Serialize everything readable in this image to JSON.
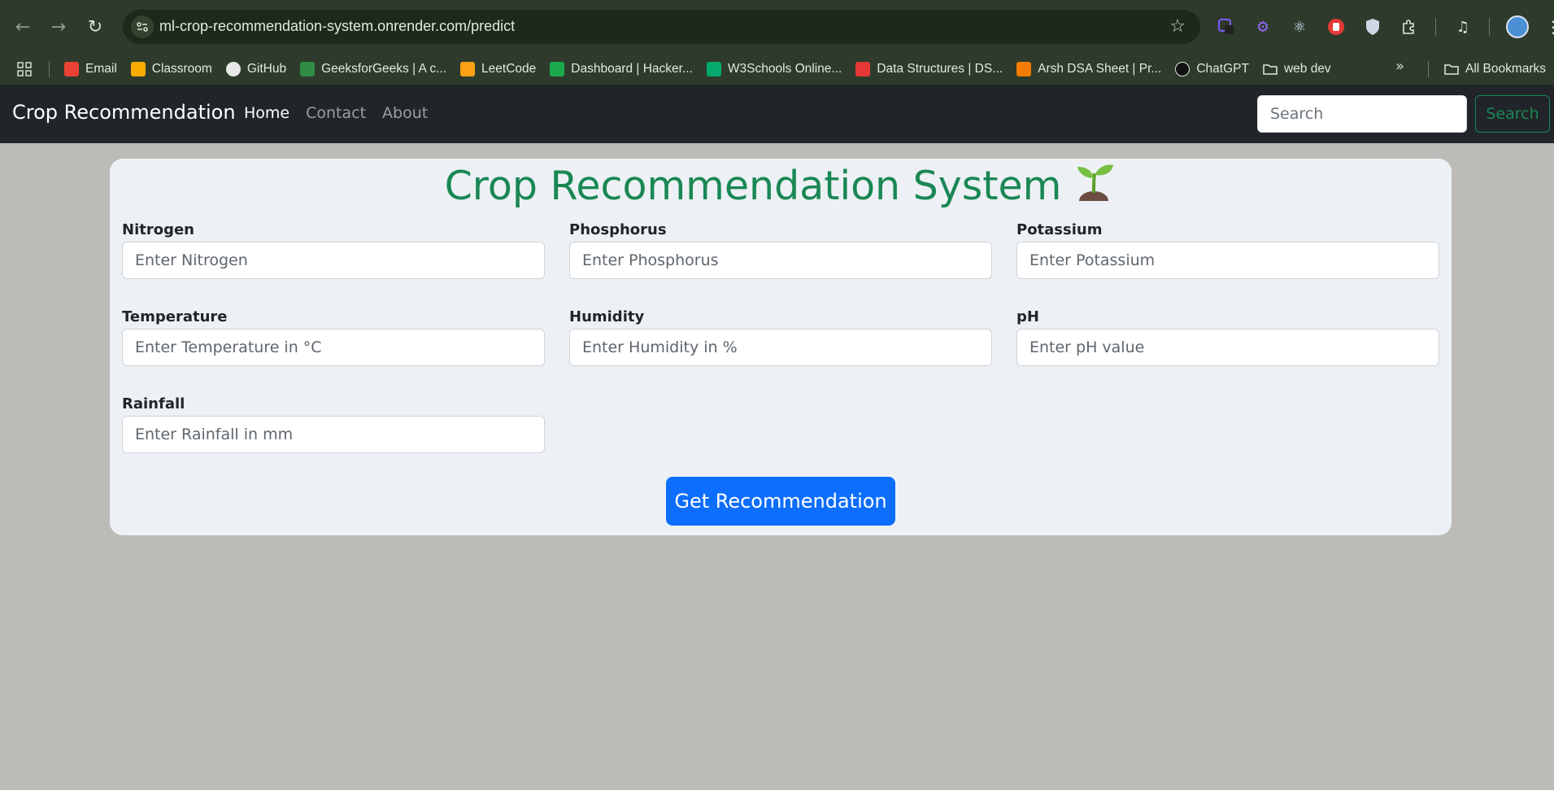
{
  "browser": {
    "url": "ml-crop-recommendation-system.onrender.com/predict",
    "bookmarks": [
      {
        "label": "Email",
        "icon": "gmail-icon",
        "color": "#ea4335"
      },
      {
        "label": "Classroom",
        "icon": "classroom-icon",
        "color": "#f9ab00"
      },
      {
        "label": "GitHub",
        "icon": "github-icon",
        "color": "#e8e8e8"
      },
      {
        "label": "GeeksforGeeks | A c...",
        "icon": "gfg-icon",
        "color": "#2f8d46"
      },
      {
        "label": "LeetCode",
        "icon": "leetcode-icon",
        "color": "#ffa116"
      },
      {
        "label": "Dashboard | Hacker...",
        "icon": "hackerrank-icon",
        "color": "#1ba94c"
      },
      {
        "label": "W3Schools Online...",
        "icon": "w3schools-icon",
        "color": "#04aa6d"
      },
      {
        "label": "Data Structures | DS...",
        "icon": "tuf-icon",
        "color": "#e53935"
      },
      {
        "label": "Arsh DSA Sheet | Pr...",
        "icon": "dsa-sheet-icon",
        "color": "#f57c00"
      },
      {
        "label": "ChatGPT",
        "icon": "chatgpt-icon",
        "color": "#111111"
      },
      {
        "label": "web dev",
        "icon": "folder-icon",
        "color": "#2e3b2c"
      }
    ],
    "all_bookmarks": "All Bookmarks"
  },
  "navbar": {
    "brand": "Crop Recommendation",
    "links": [
      "Home",
      "Contact",
      "About"
    ],
    "search_placeholder": "Search",
    "search_button": "Search"
  },
  "form": {
    "title": "Crop Recommendation System",
    "fields": [
      {
        "label": "Nitrogen",
        "placeholder": "Enter Nitrogen"
      },
      {
        "label": "Phosphorus",
        "placeholder": "Enter Phosphorus"
      },
      {
        "label": "Potassium",
        "placeholder": "Enter Potassium"
      },
      {
        "label": "Temperature",
        "placeholder": "Enter Temperature in °C"
      },
      {
        "label": "Humidity",
        "placeholder": "Enter Humidity in %"
      },
      {
        "label": "pH",
        "placeholder": "Enter pH value"
      },
      {
        "label": "Rainfall",
        "placeholder": "Enter Rainfall in mm"
      }
    ],
    "submit": "Get Recommendation"
  },
  "colors": {
    "accent": "#198754",
    "primary": "#0d6efd",
    "navbar_bg": "#212529",
    "page_bg": "#bcbbb7"
  }
}
